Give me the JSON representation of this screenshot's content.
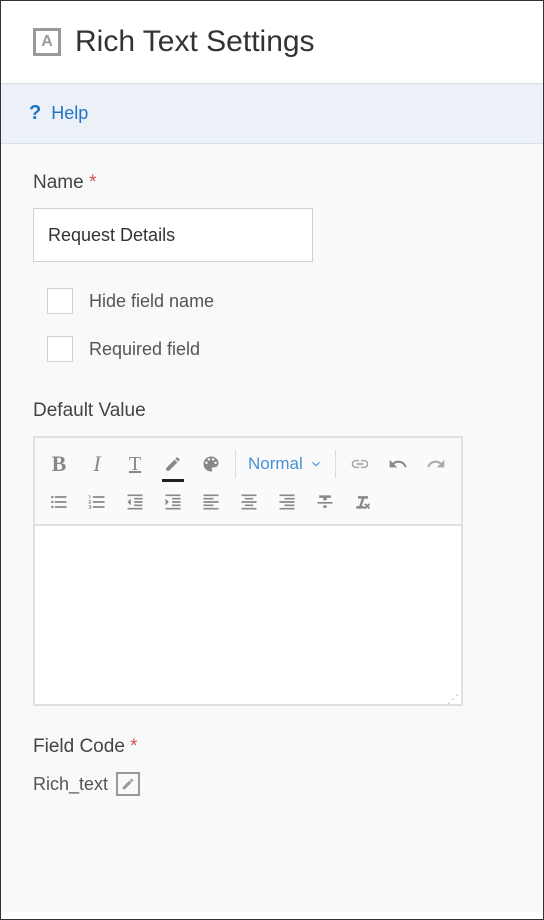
{
  "header": {
    "icon_letter": "A",
    "title": "Rich Text Settings"
  },
  "help": {
    "label": "Help"
  },
  "form": {
    "name": {
      "label": "Name",
      "value": "Request Details"
    },
    "hide_field_name": {
      "label": "Hide field name",
      "checked": false
    },
    "required_field": {
      "label": "Required field",
      "checked": false
    },
    "default_value": {
      "label": "Default Value"
    },
    "field_code": {
      "label": "Field Code",
      "value": "Rich_text"
    }
  },
  "toolbar": {
    "size_label": "Normal"
  }
}
